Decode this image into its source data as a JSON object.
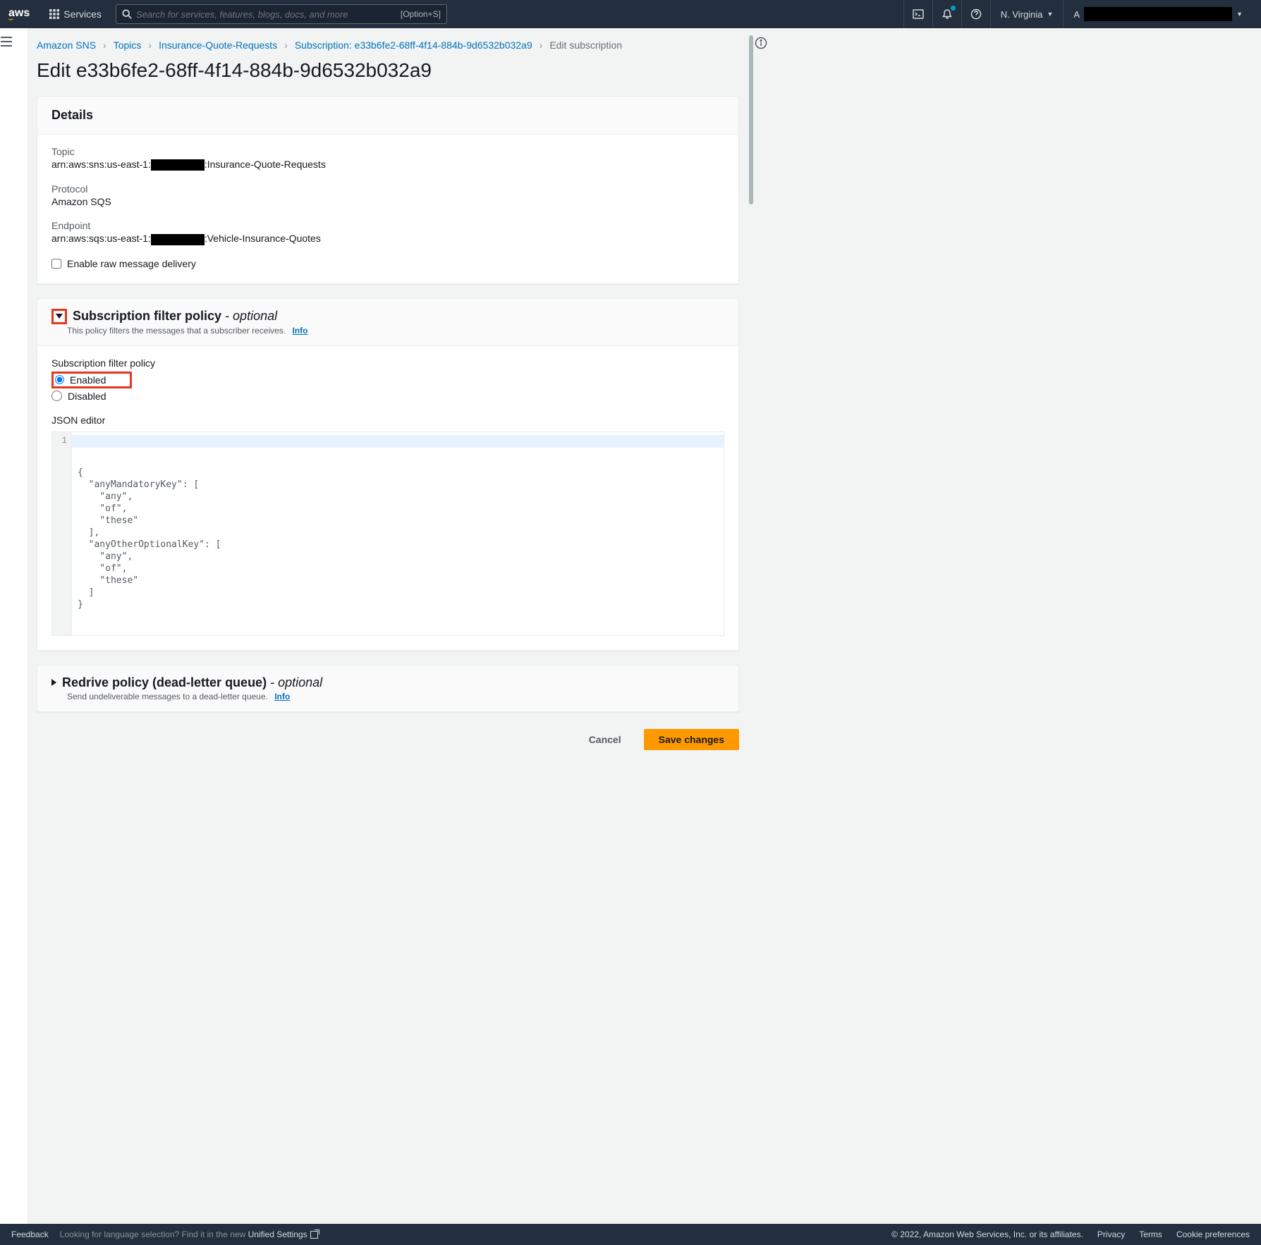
{
  "topnav": {
    "services": "Services",
    "search_placeholder": "Search for services, features, blogs, docs, and more",
    "search_shortcut": "[Option+S]",
    "region": "N. Virginia",
    "account_prefix": "A"
  },
  "breadcrumbs": {
    "root": "Amazon SNS",
    "topics": "Topics",
    "topic_name": "Insurance-Quote-Requests",
    "subscription": "Subscription: e33b6fe2-68ff-4f14-884b-9d6532b032a9",
    "current": "Edit subscription"
  },
  "page_title": "Edit e33b6fe2-68ff-4f14-884b-9d6532b032a9",
  "details": {
    "header": "Details",
    "topic_label": "Topic",
    "topic_prefix": "arn:aws:sns:us-east-1:",
    "topic_suffix": ":Insurance-Quote-Requests",
    "protocol_label": "Protocol",
    "protocol_value": "Amazon SQS",
    "endpoint_label": "Endpoint",
    "endpoint_prefix": "arn:aws:sqs:us-east-1:",
    "endpoint_suffix": ":Vehicle-Insurance-Quotes",
    "raw_delivery": "Enable raw message delivery"
  },
  "filter": {
    "title": "Subscription filter policy",
    "optional": "- optional",
    "desc": "This policy filters the messages that a subscriber receives.",
    "info": "Info",
    "policy_label": "Subscription filter policy",
    "enabled": "Enabled",
    "disabled": "Disabled",
    "json_label": "JSON editor",
    "line_number": "1",
    "code": "{\n  \"anyMandatoryKey\": [\n    \"any\",\n    \"of\",\n    \"these\"\n  ],\n  \"anyOtherOptionalKey\": [\n    \"any\",\n    \"of\",\n    \"these\"\n  ]\n}"
  },
  "redrive": {
    "title": "Redrive policy (dead-letter queue)",
    "optional": "- optional",
    "desc": "Send undeliverable messages to a dead-letter queue.",
    "info": "Info"
  },
  "actions": {
    "cancel": "Cancel",
    "save": "Save changes"
  },
  "footer": {
    "feedback": "Feedback",
    "lang_prompt": "Looking for language selection? Find it in the new",
    "lang_link": "Unified Settings",
    "copyright": "© 2022, Amazon Web Services, Inc. or its affiliates.",
    "privacy": "Privacy",
    "terms": "Terms",
    "cookie": "Cookie preferences"
  }
}
